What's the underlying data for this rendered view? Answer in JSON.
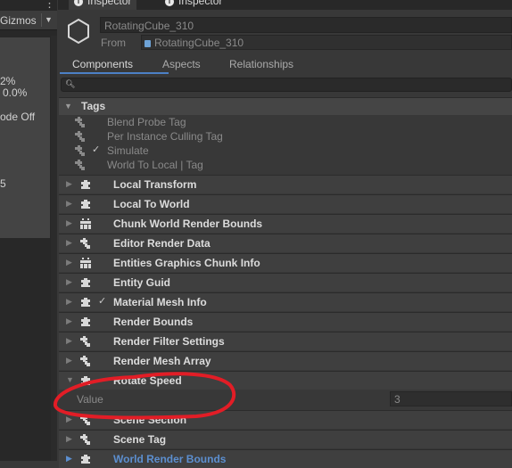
{
  "scene": {
    "gizmos_label": "Gizmos",
    "stats": [
      "2%",
      "0.0%",
      "ode Off",
      "5"
    ]
  },
  "inspector": {
    "tabs": [
      {
        "label": "Inspector",
        "icon": "info-icon"
      },
      {
        "label": "Inspector",
        "icon": "info-icon"
      }
    ],
    "entity_name": "RotatingCube_310",
    "from_label": "From",
    "from_value": "RotatingCube_310",
    "subtabs": [
      "Components",
      "Aspects",
      "Relationships"
    ],
    "active_subtab": "Components",
    "search": {
      "value": ""
    },
    "tags": {
      "header": "Tags",
      "items": [
        {
          "label": "Blend Probe Tag",
          "checked": false
        },
        {
          "label": "Per Instance Culling Tag",
          "checked": false
        },
        {
          "label": "Simulate",
          "checked": true
        },
        {
          "label": "World To Local | Tag",
          "checked": false
        }
      ]
    },
    "components": [
      {
        "label": "Local Transform",
        "icon": "puzzle-icon"
      },
      {
        "label": "Local To World",
        "icon": "puzzle-icon"
      },
      {
        "label": "Chunk World Render Bounds",
        "icon": "chunk-puzzle-icon"
      },
      {
        "label": "Editor Render Data",
        "icon": "shared-puzzle-icon"
      },
      {
        "label": "Entities Graphics Chunk Info",
        "icon": "chunk-puzzle-icon"
      },
      {
        "label": "Entity Guid",
        "icon": "puzzle-icon"
      },
      {
        "label": "Material Mesh Info",
        "icon": "puzzle-icon",
        "checked": true
      },
      {
        "label": "Render Bounds",
        "icon": "puzzle-icon"
      },
      {
        "label": "Render Filter Settings",
        "icon": "shared-puzzle-icon"
      },
      {
        "label": "Render Mesh Array",
        "icon": "shared-puzzle-icon"
      },
      {
        "label": "Rotate Speed",
        "icon": "puzzle-icon",
        "expanded": true
      },
      {
        "label": "Scene Section",
        "icon": "shared-puzzle-icon"
      },
      {
        "label": "Scene Tag",
        "icon": "shared-puzzle-icon"
      },
      {
        "label": "World Render Bounds",
        "icon": "puzzle-icon",
        "selected": true
      }
    ],
    "rotate_speed_field": {
      "label": "Value",
      "value": "3"
    }
  },
  "colors": {
    "accent": "#4c80c6",
    "annotation": "#e8202a"
  }
}
